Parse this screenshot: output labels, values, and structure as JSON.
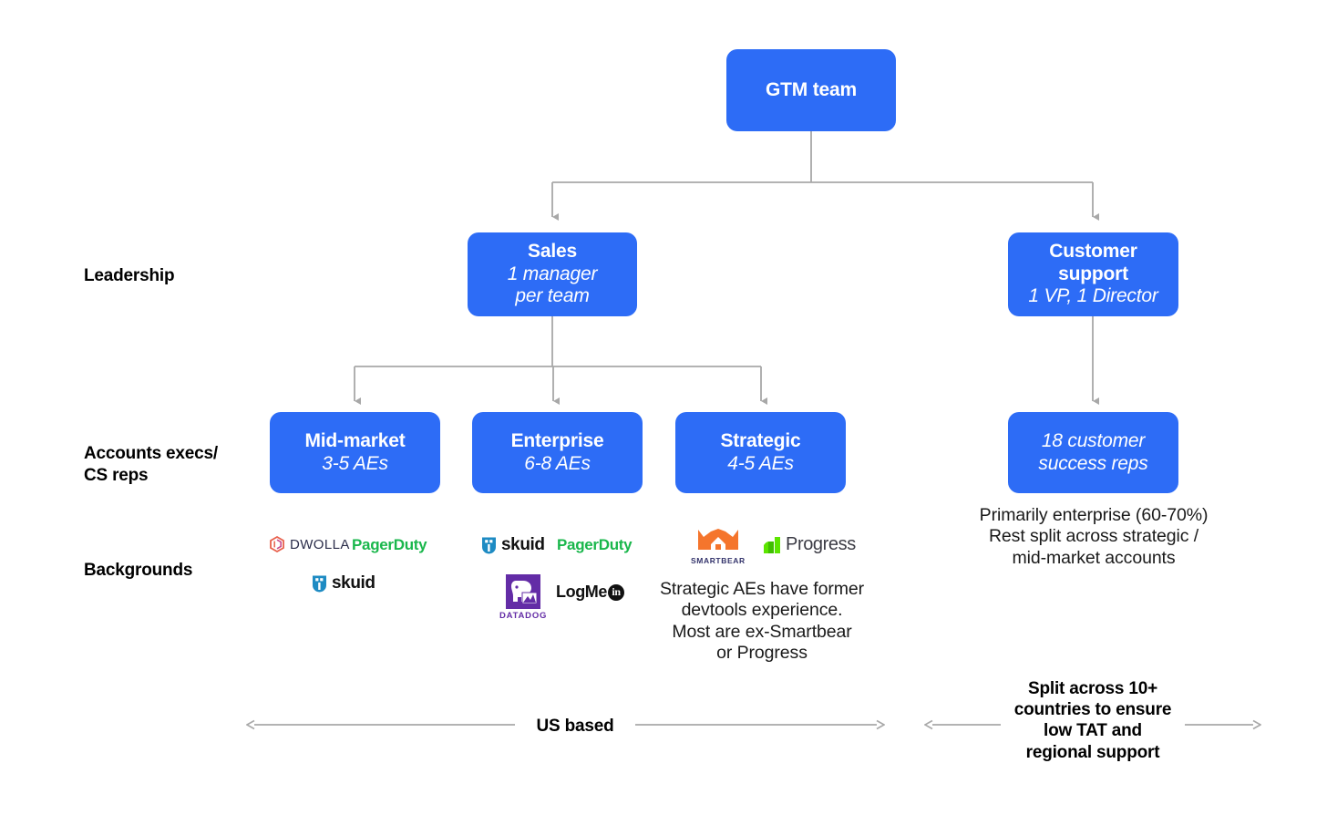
{
  "colors": {
    "node_blue": "#2D6CF6",
    "connector_gray": "#a8a8a8",
    "text_black": "#111111",
    "pagerduty_green": "#1ab74c",
    "smartbear_orange": "#f5752c",
    "progress_green": "#5ce500",
    "datadog_purple": "#632ca6",
    "skuid_blue": "#1e8bc3",
    "dwolla_orange": "#e8604c"
  },
  "nodes": {
    "gtm": {
      "title": "GTM team",
      "subtitle": ""
    },
    "sales": {
      "title": "Sales",
      "subtitle_line1": "1 manager",
      "subtitle_line2": "per team"
    },
    "customer_support": {
      "title_line1": "Customer",
      "title_line2": "support",
      "subtitle": "1 VP, 1 Director"
    },
    "mid_market": {
      "title": "Mid-market",
      "subtitle": "3-5 AEs"
    },
    "enterprise": {
      "title": "Enterprise",
      "subtitle": "6-8 AEs"
    },
    "strategic": {
      "title": "Strategic",
      "subtitle": "4-5 AEs"
    },
    "cs_reps": {
      "subtitle_line1": "18 customer",
      "subtitle_line2": "success reps"
    }
  },
  "row_labels": {
    "leadership": "Leadership",
    "account_execs_line1": "Accounts execs/",
    "account_execs_line2": "CS reps",
    "backgrounds": "Backgrounds"
  },
  "logos": {
    "dwolla": "DWOLLA",
    "pagerduty": "PagerDuty",
    "skuid": "skuid",
    "logmein_main": "LogMe",
    "logmein_badge": "in",
    "smartbear": "SMARTBEAR",
    "progress": "Progress",
    "datadog": "DATADOG"
  },
  "notes": {
    "strategic_note_line1": "Strategic AEs have former",
    "strategic_note_line2": "devtools experience.",
    "strategic_note_line3": "Most are ex-Smartbear",
    "strategic_note_line4": "or Progress",
    "cs_note_line1": "Primarily enterprise (60-70%)",
    "cs_note_line2": "Rest split across strategic /",
    "cs_note_line3": "mid-market accounts"
  },
  "axis": {
    "us_based": "US based",
    "global_line1": "Split across 10+",
    "global_line2": "countries to ensure",
    "global_line3": "low TAT and",
    "global_line4": "regional support"
  }
}
